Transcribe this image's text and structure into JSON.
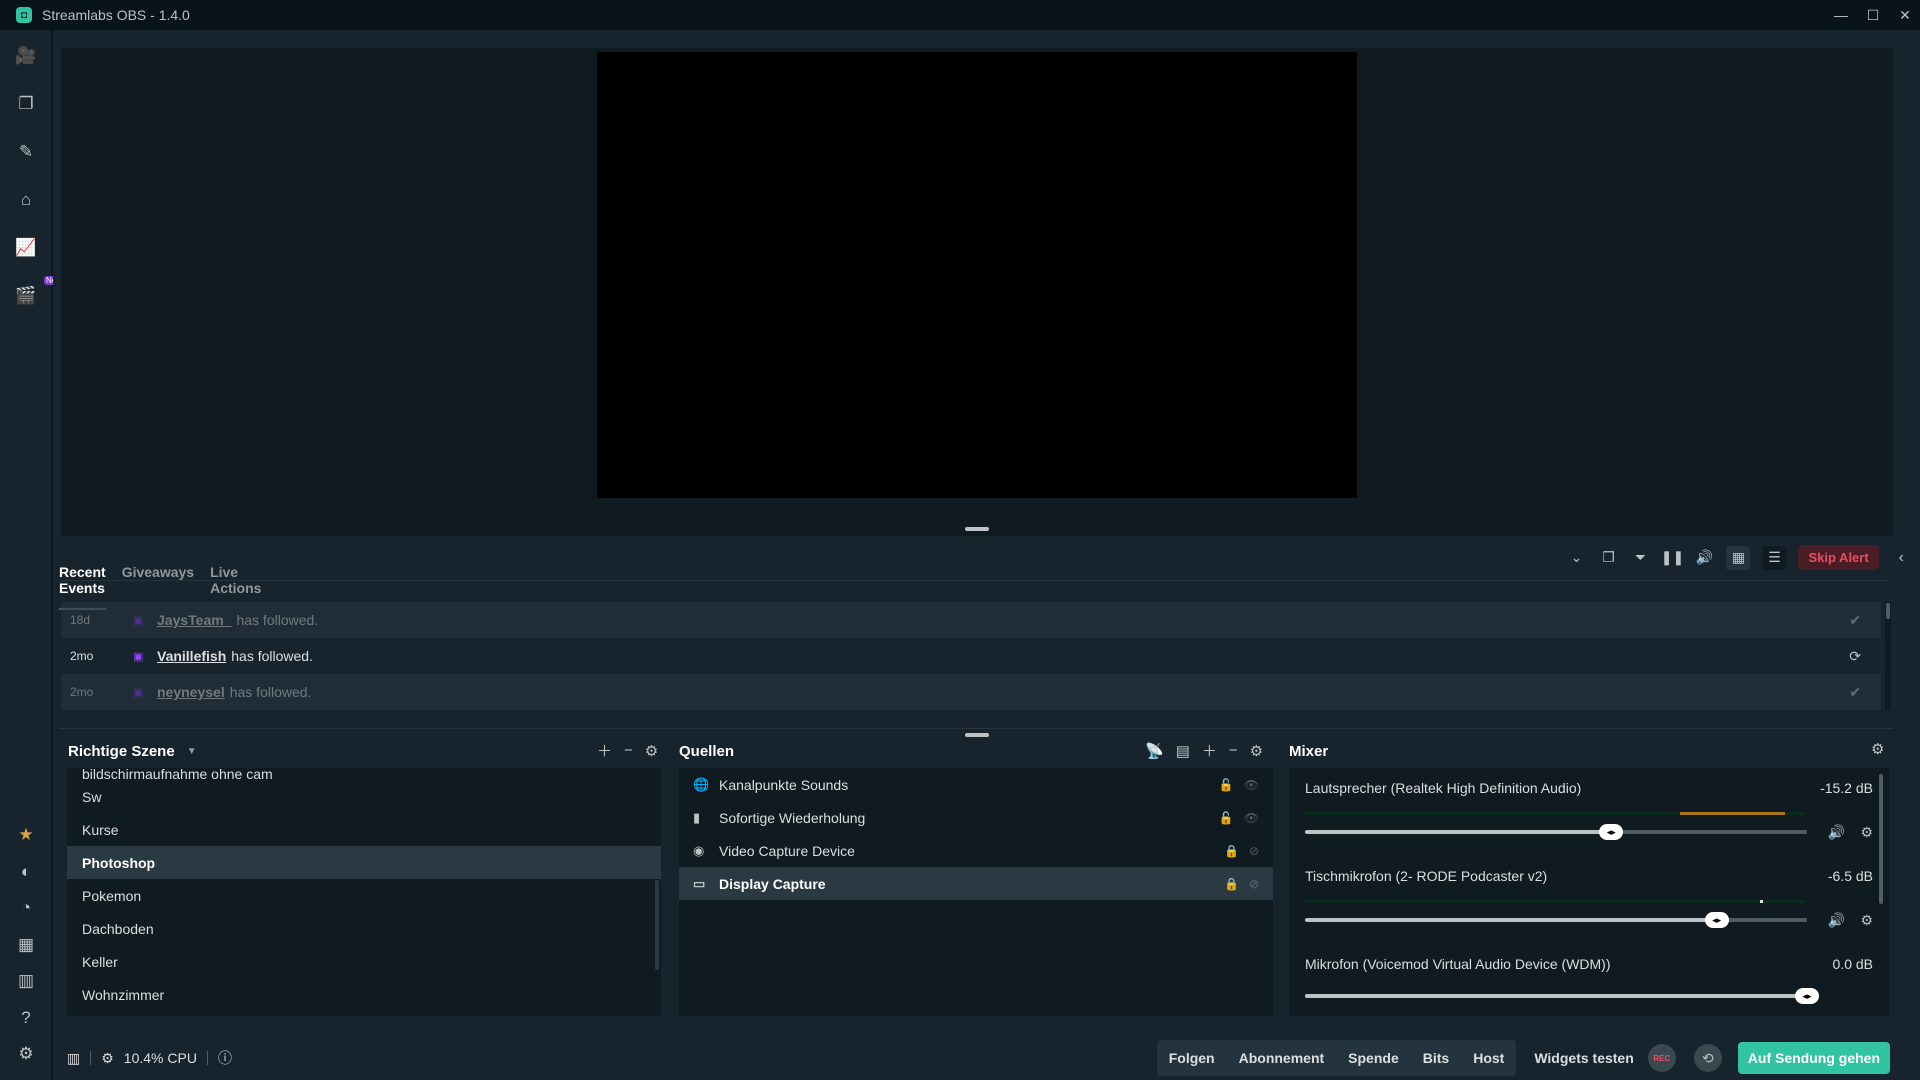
{
  "window": {
    "title": "Streamlabs OBS - 1.4.0",
    "minimize": "—",
    "maximize": "☐",
    "close": "✕"
  },
  "sidenav": {
    "top": [
      {
        "name": "studio",
        "glyph": "🎥"
      },
      {
        "name": "themes",
        "glyph": "❐"
      },
      {
        "name": "editor",
        "glyph": "✎"
      },
      {
        "name": "store",
        "glyph": "⌂"
      },
      {
        "name": "analytics",
        "glyph": "📈"
      },
      {
        "name": "highlighter",
        "glyph": "🎬",
        "badge": "Neu"
      }
    ],
    "bottom": [
      {
        "name": "prime",
        "glyph": "★"
      },
      {
        "name": "dashboard",
        "glyph": "◐"
      },
      {
        "name": "chat",
        "glyph": "◔"
      },
      {
        "name": "layouts",
        "glyph": "▦"
      },
      {
        "name": "studio-mode",
        "glyph": "▥"
      },
      {
        "name": "help",
        "glyph": "?"
      },
      {
        "name": "settings",
        "glyph": "⚙"
      }
    ]
  },
  "events": {
    "tabs": [
      {
        "label": "Recent Events",
        "active": true
      },
      {
        "label": "Giveaways"
      },
      {
        "label": "Live Actions"
      }
    ],
    "skip_alert": "Skip Alert",
    "items": [
      {
        "time": "18d",
        "user": "JaysTeam_",
        "action": "has followed.",
        "state": "dim",
        "status": "✔"
      },
      {
        "time": "2mo",
        "user": "Vanillefish",
        "action": "has followed.",
        "state": "bright",
        "status": "⟳"
      },
      {
        "time": "2mo",
        "user": "neyneysel",
        "action": "has followed.",
        "state": "dim",
        "status": "✔"
      }
    ]
  },
  "scenes": {
    "title": "Richtige Szene",
    "items": [
      "bildschirmaufnahme ohne cam",
      "Sw",
      "Kurse",
      "Photoshop",
      "Pokemon",
      "Dachboden",
      "Keller",
      "Wohnzimmer"
    ],
    "selected": "Photoshop"
  },
  "sources": {
    "title": "Quellen",
    "items": [
      {
        "label": "Kanalpunkte Sounds",
        "icon": "🌐"
      },
      {
        "label": "Sofortige Wiederholung",
        "icon": "▮"
      },
      {
        "label": "Video Capture Device",
        "icon": "◉"
      },
      {
        "label": "Display Capture",
        "icon": "▭",
        "selected": true
      }
    ]
  },
  "mixer": {
    "title": "Mixer",
    "items": [
      {
        "name": "Lautsprecher (Realtek High Definition Audio)",
        "db": "-15.2 dB",
        "volume": 0.61
      },
      {
        "name": "Tischmikrofon (2- RODE Podcaster v2)",
        "db": "-6.5 dB",
        "volume": 0.82
      },
      {
        "name": "Mikrofon (Voicemod Virtual Audio Device (WDM))",
        "db": "0.0 dB",
        "volume": 1.0
      }
    ]
  },
  "footer": {
    "cpu": "10.4% CPU",
    "test_buttons": [
      "Folgen",
      "Abonnement",
      "Spende",
      "Bits",
      "Host"
    ],
    "widgets_label": "Widgets testen",
    "rec_label": "REC",
    "go_live": "Auf Sendung gehen"
  }
}
